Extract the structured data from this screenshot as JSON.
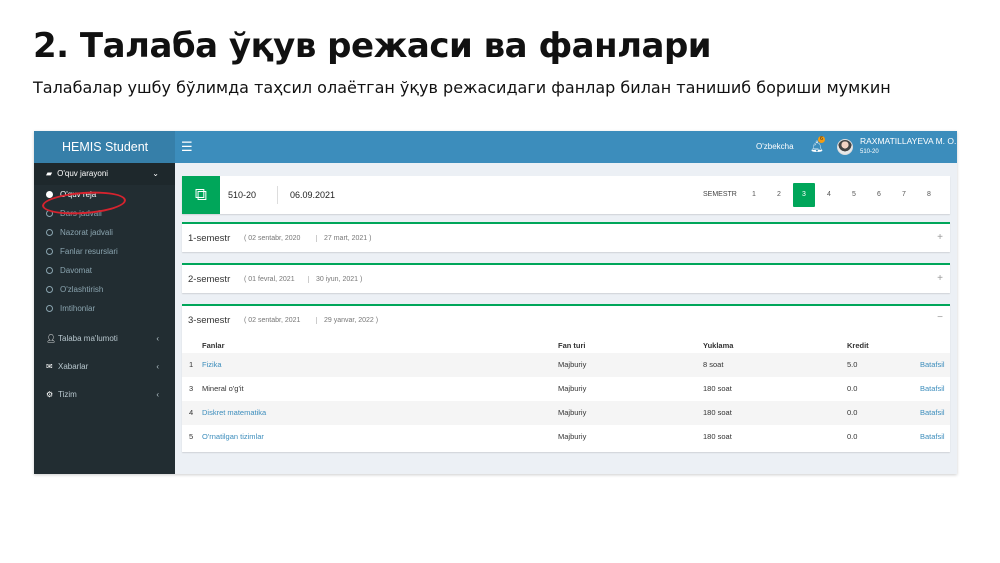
{
  "slide": {
    "title": "2. Талаба ўқув режаси ва фанлари",
    "subtitle": "Талабалар ушбу бўлимда таҳсил олаётган ўқув режасидаги фанлар билан танишиб бориши мумкин"
  },
  "topbar": {
    "brand": "HEMIS Student",
    "menu_icon": "hamburger-icon",
    "language": "O'zbekcha",
    "notifications_icon": "bell-icon",
    "notifications_count": "6",
    "user_name": "RAXMATILLAYEVA M. O.",
    "user_group": "510-20"
  },
  "sidebar": {
    "section": {
      "label": "O'quv jarayoni",
      "icon": "book-icon"
    },
    "subitems": [
      {
        "label": "O'quv reja",
        "active": true
      },
      {
        "label": "Dars jadvali"
      },
      {
        "label": "Nazorat jadvali"
      },
      {
        "label": "Fanlar resurslari"
      },
      {
        "label": "Davomat"
      },
      {
        "label": "O'zlashtirish"
      },
      {
        "label": "Imtihonlar"
      }
    ],
    "main_items": [
      {
        "label": "Talaba ma'lumoti",
        "icon": "user-icon"
      },
      {
        "label": "Xabarlar",
        "icon": "envelope-icon"
      },
      {
        "label": "Tizim",
        "icon": "gear-icon"
      }
    ]
  },
  "plan": {
    "icon": "copy-icon",
    "group": "510-20",
    "date": "06.09.2021",
    "semester_label": "SEMESTR",
    "semesters": [
      "1",
      "2",
      "3",
      "4",
      "5",
      "6",
      "7",
      "8"
    ],
    "active_semester": "3"
  },
  "semesters": [
    {
      "name": "1-semestr",
      "start": "( 02 sentabr, 2020",
      "end": "27 mart, 2021 )",
      "toggle": "+"
    },
    {
      "name": "2-semestr",
      "start": "( 01 fevral, 2021",
      "end": "30 iyun, 2021 )",
      "toggle": "+"
    },
    {
      "name": "3-semestr",
      "start": "( 02 sentabr, 2021",
      "end": "29 yanvar, 2022 )",
      "toggle": "−"
    }
  ],
  "table": {
    "headers": {
      "subject": "Fanlar",
      "type": "Fan turi",
      "load": "Yuklama",
      "credit": "Kredit"
    },
    "rows": [
      {
        "num": "1",
        "subject": "Fizika",
        "type": "Majburiy",
        "load": "8 soat",
        "credit": "5.0",
        "action": "Batafsil"
      },
      {
        "num": "3",
        "subject": "Mineral o'g'it",
        "type": "Majburiy",
        "load": "180 soat",
        "credit": "0.0",
        "action": "Batafsil"
      },
      {
        "num": "4",
        "subject": "Diskret matematika",
        "type": "Majburiy",
        "load": "180 soat",
        "credit": "0.0",
        "action": "Batafsil"
      },
      {
        "num": "5",
        "subject": "O'rnatilgan tizimlar",
        "type": "Majburiy",
        "load": "180 soat",
        "credit": "0.0",
        "action": "Batafsil"
      }
    ]
  },
  "colors": {
    "primary": "#3c8dbc",
    "sidebar": "#222d32",
    "accent": "#00a65a",
    "annotation": "#d7232e"
  }
}
